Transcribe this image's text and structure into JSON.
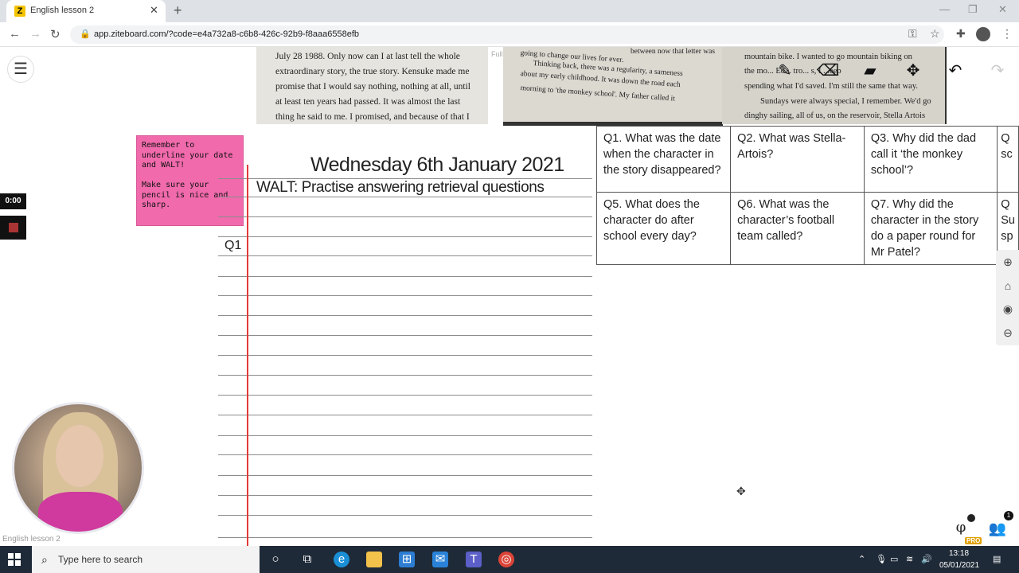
{
  "browser": {
    "tab_title": "English lesson 2",
    "tab_favicon": "Z",
    "new_tab": "+",
    "url": "app.ziteboard.com/?code=e4a732a8-c6b8-426c-92b9-f8aaa6558efb",
    "icons": [
      "back-icon",
      "forward-icon",
      "reload-icon",
      "lock-icon",
      "key-icon",
      "star-icon",
      "extension-icon",
      "profile-icon",
      "kebab-icon"
    ]
  },
  "board": {
    "fullscreen_label": "Fullscreen",
    "toolbar": [
      "pencil-icon",
      "eraser-icon",
      "sticky-note-icon",
      "move-icon",
      "undo-icon",
      "redo-icon"
    ],
    "sticky_note": "Remember to\nunderline your date\nand WALT!\n\nMake sure your\npencil is nice and\nsharp.",
    "timer": "0:00",
    "date_title": "Wednesday 6th January 2021",
    "walt": "WALT: Practise answering retrieval questions",
    "q1_label": "Q1",
    "video_label": "English lesson 2",
    "users_count": "1",
    "pro_badge": "PRO",
    "phi": "φ"
  },
  "book_photos": {
    "photo1": [
      "July 28 1988. Only now can I at last tell the whole",
      "extraordinary story, the true story. Kensuke made me",
      "promise that I would say nothing, nothing at all, until",
      "at least ten years had passed. It was almost the last",
      "thing he said to me. I promised, and because of that I"
    ],
    "photo2": [
      "going to change our lives for ever.",
      "Thinking back, there was a regularity, a sameness",
      "about my early childhood. It was down the road each",
      "morning to 'the monkey school'. My father called it"
    ],
    "photo2_top_fragment": "between now that letter was",
    "photo3": [
      "mountain bike. I wanted to go mountain biking on",
      "the mo... Ed... tro... s, I ...eep",
      "spending what I'd saved. I'm still the same that way.",
      "Sundays were always special, I remember. We'd go",
      "dinghy sailing, all of us, on the reservoir, Stella Artois"
    ]
  },
  "questions": {
    "row1": [
      "Q1. What was the date when the character in the story disappeared?",
      "Q2. What was Stella-Artois?",
      "Q3. Why did the dad call it ‘the monkey school’?",
      "Q\nsc"
    ],
    "row2": [
      "Q5. What does the character do after school every day?",
      "Q6. What was the character’s football team called?",
      "Q7. Why did the character in the story do a paper round for Mr Patel?",
      "Q\nSu\nsp"
    ]
  },
  "taskbar": {
    "search_placeholder": "Type here to search",
    "time": "13:18",
    "date": "05/01/2021"
  }
}
